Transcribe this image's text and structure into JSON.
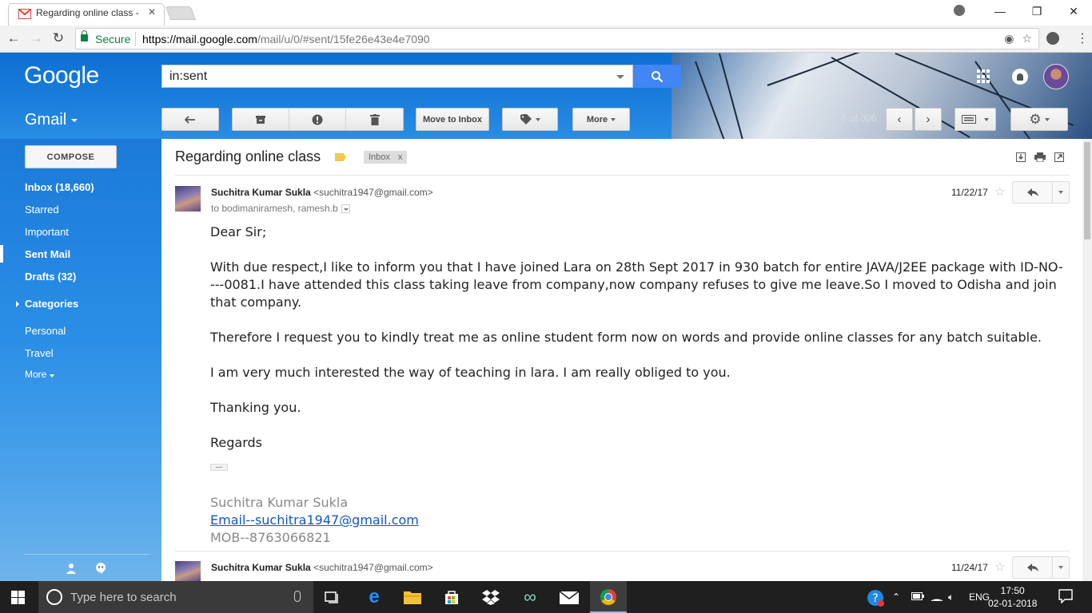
{
  "browser": {
    "tab_title": "Regarding online class -",
    "secure_label": "Secure",
    "url_host": "https://mail.google.com",
    "url_path": "/mail/u/0/#sent/15fe26e43e4e7090"
  },
  "gmail": {
    "logo": "Google",
    "search_query": "in:sent",
    "app_label": "Gmail",
    "toolbar": {
      "move_to_inbox": "Move to Inbox",
      "more": "More",
      "pager": "6 of 306"
    },
    "compose": "COMPOSE",
    "nav": {
      "inbox": "Inbox (18,660)",
      "starred": "Starred",
      "important": "Important",
      "sent": "Sent Mail",
      "drafts": "Drafts (32)",
      "categories": "Categories",
      "personal": "Personal",
      "travel": "Travel",
      "more": "More"
    },
    "thread": {
      "subject": "Regarding online class",
      "label": "Inbox",
      "label_remove": "x",
      "message1": {
        "sender_name": "Suchitra Kumar Sukla",
        "sender_email": "<suchitra1947@gmail.com>",
        "recipients": "to bodimaniramesh, ramesh.b",
        "date": "11/22/17",
        "body": [
          "Dear Sir;",
          "With due respect,I like to inform you that I have joined Lara on 28th Sept 2017 in 930 batch for entire JAVA/J2EE package with ID-NO----0081.I have attended this class taking leave from company,now company refuses to give me leave.So I moved to Odisha and join that company.",
          "Therefore I request you to kindly treat me as online student form now on words and provide online classes for any batch suitable.",
          "I am very much interested the way of teaching in lara. I am really obliged to you.",
          "Thanking you.",
          "Regards"
        ],
        "ellipsis": "...",
        "signature": {
          "name": "Suchitra Kumar Sukla",
          "email": "Email--suchitra1947@gmail.com",
          "mobile": "MOB--8763066821"
        }
      },
      "message2": {
        "sender_name": "Suchitra Kumar Sukla",
        "sender_email": "<suchitra1947@gmail.com>",
        "date": "11/24/17"
      }
    }
  },
  "taskbar": {
    "search_placeholder": "Type here to search",
    "language": "ENG",
    "time": "17:50",
    "date": "02-01-2018"
  },
  "colors": {
    "gmail_blue": "#1a7edc",
    "search_button": "#4285f4",
    "link": "#1155cc",
    "secure_green": "#0b8043"
  }
}
